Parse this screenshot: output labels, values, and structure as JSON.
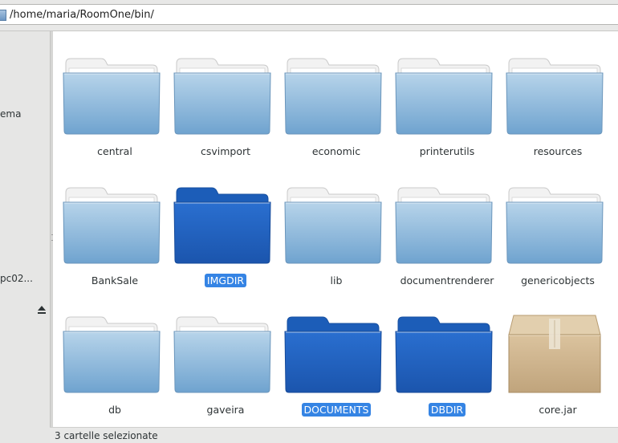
{
  "location": {
    "path": "/home/maria/RoomOne/bin/"
  },
  "sidebar": {
    "items": [
      {
        "label": "ema"
      },
      {
        "label": "pc02..."
      }
    ]
  },
  "files": [
    {
      "name": "central",
      "kind": "folder",
      "selected": false
    },
    {
      "name": "csvimport",
      "kind": "folder",
      "selected": false
    },
    {
      "name": "economic",
      "kind": "folder",
      "selected": false
    },
    {
      "name": "printerutils",
      "kind": "folder",
      "selected": false
    },
    {
      "name": "resources",
      "kind": "folder",
      "selected": false
    },
    {
      "name": "BankSale",
      "kind": "folder",
      "selected": false
    },
    {
      "name": "IMGDIR",
      "kind": "folder",
      "selected": true
    },
    {
      "name": "lib",
      "kind": "folder",
      "selected": false
    },
    {
      "name": "documentrenderer",
      "kind": "folder",
      "selected": false
    },
    {
      "name": "genericobjects",
      "kind": "folder",
      "selected": false
    },
    {
      "name": "db",
      "kind": "folder",
      "selected": false
    },
    {
      "name": "gaveira",
      "kind": "folder",
      "selected": false
    },
    {
      "name": "DOCUMENTS",
      "kind": "folder",
      "selected": true
    },
    {
      "name": "DBDIR",
      "kind": "folder",
      "selected": true
    },
    {
      "name": "core.jar",
      "kind": "archive",
      "selected": false
    }
  ],
  "status": {
    "text": "3 cartelle selezionate"
  },
  "colors": {
    "selection": "#3584e4",
    "folder_normal": "#7fb0d8",
    "folder_selected": "#1c5db8",
    "archive": "#cdb28a"
  },
  "icons": {
    "folder": "folder-icon",
    "archive": "package-icon",
    "eject": "eject-icon"
  }
}
